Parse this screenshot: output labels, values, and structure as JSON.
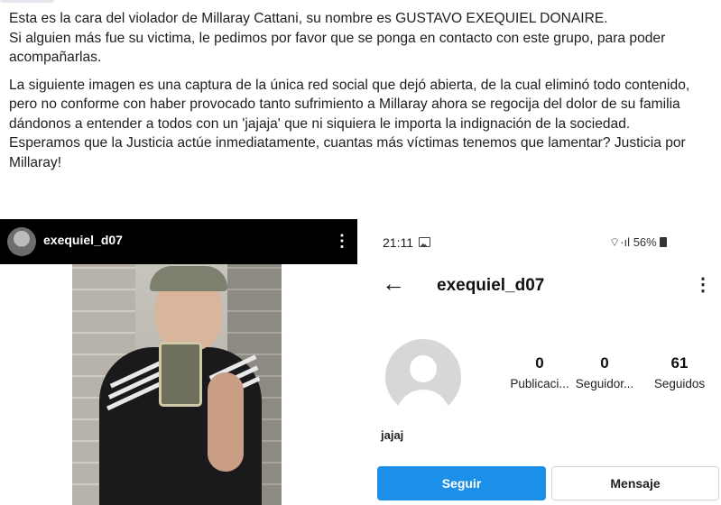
{
  "post": {
    "paragraphs": [
      "Esta es la cara del violador de Millaray Cattani, su nombre es GUSTAVO EXEQUIEL DONAIRE.\nSi alguien más fue su victima, le pedimos por favor que se ponga en contacto con este grupo, para poder acompañarlas.",
      "La siguiente imagen es una captura de la única red social que dejó abierta, de la cual eliminó todo contenido, pero no conforme con haber provocado tanto sufrimiento a Millaray ahora se regocija del dolor de su familia dándonos a entender a todos con un 'jajaja' que ni siquiera le importa la indignación de la sociedad.\nEsperamos que la Justicia actúe inmediatamente, cuantas más víctimas tenemos que lamentar? Justicia por Millaray!"
    ]
  },
  "left_post": {
    "username": "exequiel_d07",
    "menu_icon": "more-vertical-icon"
  },
  "profile": {
    "status_time": "21:11",
    "status_right": "56%",
    "back_icon": "back-arrow-icon",
    "username": "exequiel_d07",
    "stats": [
      {
        "value": "0",
        "label": "Publicaci..."
      },
      {
        "value": "0",
        "label": "Seguidor..."
      },
      {
        "value": "61",
        "label": "Seguidos"
      }
    ],
    "bio": "jajaj",
    "follow_label": "Seguir",
    "message_label": "Mensaje",
    "follow_color": "#1c8fe8"
  }
}
